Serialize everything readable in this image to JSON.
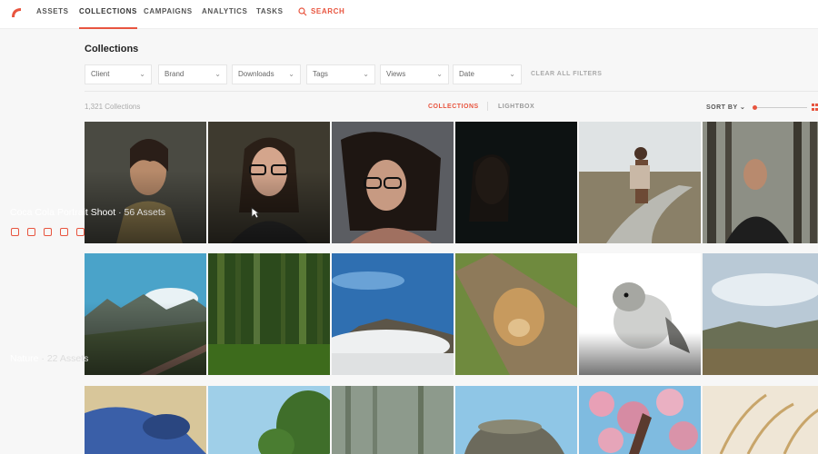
{
  "nav": {
    "items": [
      {
        "label": "ASSETS"
      },
      {
        "label": "COLLECTIONS",
        "active": true
      },
      {
        "label": "CAMPAIGNS"
      },
      {
        "label": "ANALYTICS"
      },
      {
        "label": "TASKS"
      }
    ],
    "search_label": "SEARCH"
  },
  "page": {
    "title": "Collections"
  },
  "filters": {
    "items": [
      {
        "label": "Client"
      },
      {
        "label": "Brand"
      },
      {
        "label": "Downloads"
      },
      {
        "label": "Tags"
      },
      {
        "label": "Views"
      },
      {
        "label": "Date"
      }
    ],
    "clear_label": "CLEAR ALL FILTERS"
  },
  "toolbar": {
    "count": "1,321 Collections",
    "tab_collections": "COLLECTIONS",
    "tab_lightbox": "LIGHTBOX",
    "sort_label": "SORT BY"
  },
  "tiles": {
    "captions": [
      {
        "name": "Coca Cola Portrait Shoot",
        "assets": " · 56 Assets"
      },
      {
        "name": "Nature",
        "assets": " · 22 Assets"
      }
    ]
  },
  "colors": {
    "accent": "#e8553f"
  },
  "icons": [
    "logo-icon",
    "search-icon",
    "chevron-down-icon",
    "grid-view-icon",
    "cursor-icon"
  ]
}
